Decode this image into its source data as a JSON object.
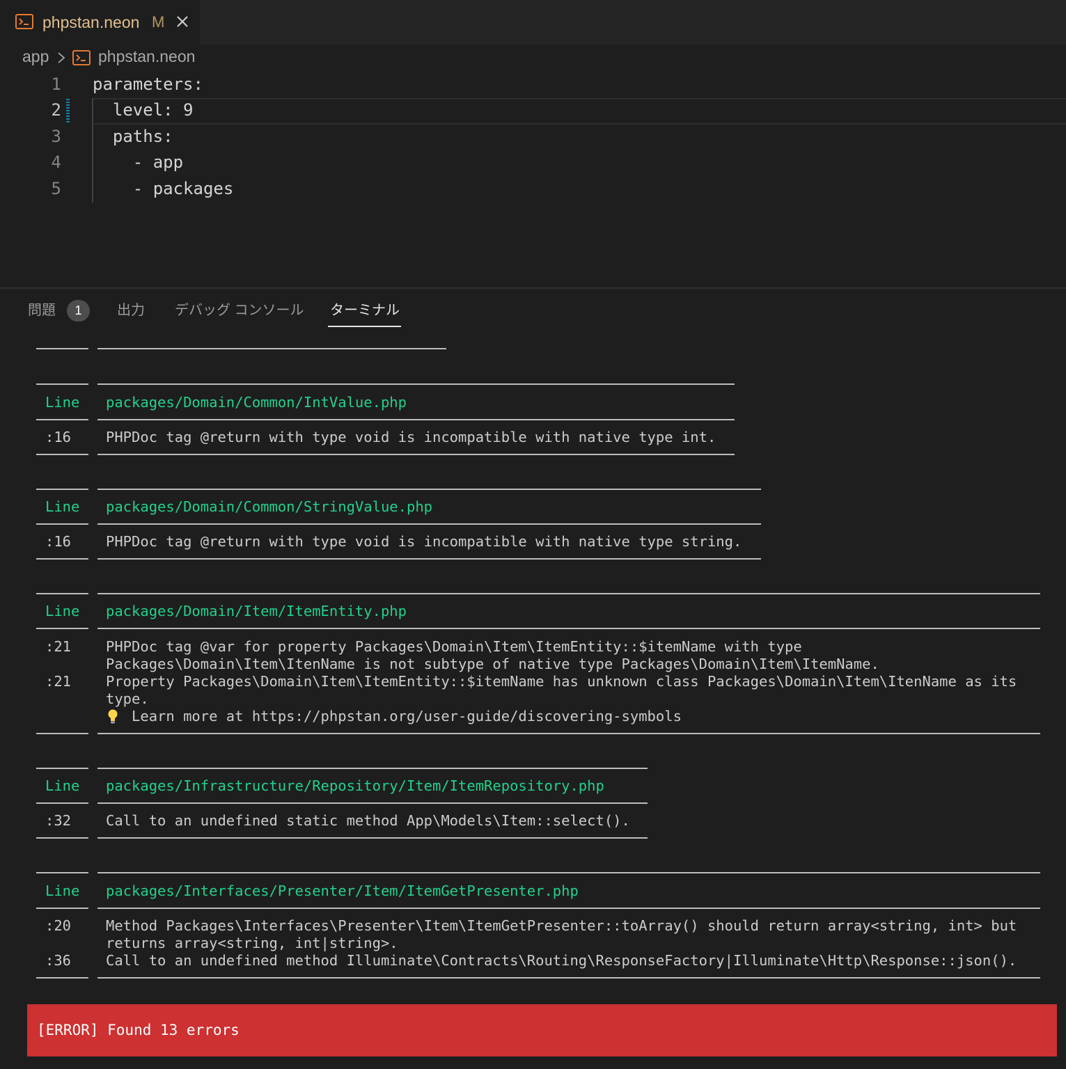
{
  "tab": {
    "title": "phpstan.neon",
    "modified": "M",
    "icon": "terminal-file-icon",
    "close_icon": "close-icon",
    "title_color": "#e2c08d"
  },
  "breadcrumb": {
    "folder": "app",
    "file": "phpstan.neon"
  },
  "editor": {
    "lines": [
      {
        "num": "1",
        "text": "parameters:"
      },
      {
        "num": "2",
        "text": "  level: 9"
      },
      {
        "num": "3",
        "text": "  paths:"
      },
      {
        "num": "4",
        "text": "    - app"
      },
      {
        "num": "5",
        "text": "    - packages"
      }
    ]
  },
  "panel": {
    "tabs": {
      "problems": "問題",
      "problems_count": "1",
      "output": "出力",
      "debug_console": "デバッグ コンソール",
      "terminal": "ターミナル"
    },
    "active_tab": "ターミナル"
  },
  "terminal": {
    "blocks": [
      {
        "header_col1": "Line",
        "file": "packages/Domain/Common/IntValue.php",
        "rows": [
          {
            "line": ":16",
            "message": "PHPDoc tag @return with type void is incompatible with native type int."
          }
        ]
      },
      {
        "header_col1": "Line",
        "file": "packages/Domain/Common/StringValue.php",
        "rows": [
          {
            "line": ":16",
            "message": "PHPDoc tag @return with type void is incompatible with native type string."
          }
        ]
      },
      {
        "header_col1": "Line",
        "file": "packages/Domain/Item/ItemEntity.php",
        "rows": [
          {
            "line": ":21",
            "message": "PHPDoc tag @var for property Packages\\Domain\\Item\\ItemEntity::$itemName with type"
          },
          {
            "line": "",
            "message": "Packages\\Domain\\Item\\ItenName is not subtype of native type Packages\\Domain\\Item\\ItemName."
          },
          {
            "line": ":21",
            "message": "Property Packages\\Domain\\Item\\ItemEntity::$itemName has unknown class Packages\\Domain\\Item\\ItenName as its"
          },
          {
            "line": "",
            "message": "type."
          },
          {
            "line": "",
            "message": "   Learn more at https://phpstan.org/user-guide/discovering-symbols"
          }
        ]
      },
      {
        "header_col1": "Line",
        "file": "packages/Infrastructure/Repository/Item/ItemRepository.php",
        "rows": [
          {
            "line": ":32",
            "message": "Call to an undefined static method App\\Models\\Item::select()."
          }
        ]
      },
      {
        "header_col1": "Line",
        "file": "packages/Interfaces/Presenter/Item/ItemGetPresenter.php",
        "rows": [
          {
            "line": ":20",
            "message": "Method Packages\\Interfaces\\Presenter\\Item\\ItemGetPresenter::toArray() should return array<string, int> but"
          },
          {
            "line": "",
            "message": "returns array<string, int|string>."
          },
          {
            "line": ":36",
            "message": "Call to an undefined method Illuminate\\Contracts\\Routing\\ResponseFactory|Illuminate\\Http\\Response::json()."
          }
        ]
      }
    ],
    "error_summary": "[ERROR] Found 13 errors",
    "error_color": "#cd3131",
    "header_color": "#23d18b"
  }
}
